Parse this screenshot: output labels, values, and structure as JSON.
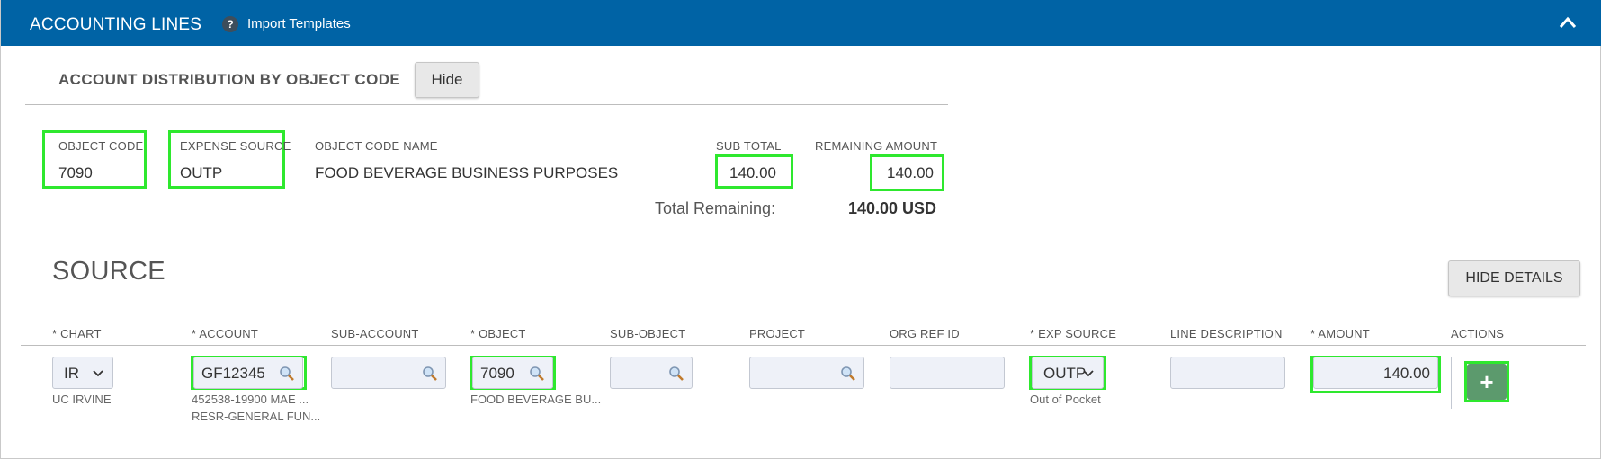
{
  "header": {
    "title": "ACCOUNTING LINES",
    "help_icon": "question-icon",
    "import_label": "Import Templates",
    "collapse_icon": "chevron-up-icon",
    "color": "#0063a5"
  },
  "distribution": {
    "title": "ACCOUNT DISTRIBUTION BY OBJECT CODE",
    "hide_label": "Hide",
    "columns": {
      "object_code": "OBJECT CODE",
      "expense_source": "EXPENSE SOURCE",
      "object_code_name": "OBJECT CODE NAME",
      "sub_total": "SUB TOTAL",
      "remaining_amount": "REMAINING AMOUNT"
    },
    "row": {
      "object_code": "7090",
      "expense_source": "OUTP",
      "object_code_name": "FOOD BEVERAGE BUSINESS PURPOSES",
      "sub_total": "140.00",
      "remaining_amount": "140.00"
    },
    "total_label": "Total Remaining:",
    "total_value": "140.00 USD"
  },
  "source": {
    "title": "SOURCE",
    "hide_details_label": "HIDE DETAILS",
    "columns": {
      "chart": "* CHART",
      "account": "* ACCOUNT",
      "sub_account": "SUB-ACCOUNT",
      "object": "* OBJECT",
      "sub_object": "SUB-OBJECT",
      "project": "PROJECT",
      "org_ref_id": "ORG REF ID",
      "exp_source": "* EXP SOURCE",
      "line_description": "LINE DESCRIPTION",
      "amount": "* AMOUNT",
      "actions": "ACTIONS"
    },
    "row": {
      "chart": "IR",
      "chart_desc": "UC IRVINE",
      "account": "GF12345",
      "account_desc_1": "452538-19900 MAE ...",
      "account_desc_2": "RESR-GENERAL FUN...",
      "sub_account": "",
      "object": "7090",
      "object_desc": "FOOD BEVERAGE BU...",
      "sub_object": "",
      "project": "",
      "org_ref_id": "",
      "exp_source": "OUTP",
      "exp_source_desc": "Out of Pocket",
      "line_description": "",
      "amount": "140.00",
      "add_icon": "plus-icon"
    }
  },
  "colors": {
    "highlight": "#2ee82e",
    "add_button": "#5c9a6d",
    "field_bg": "#eef1f8"
  }
}
